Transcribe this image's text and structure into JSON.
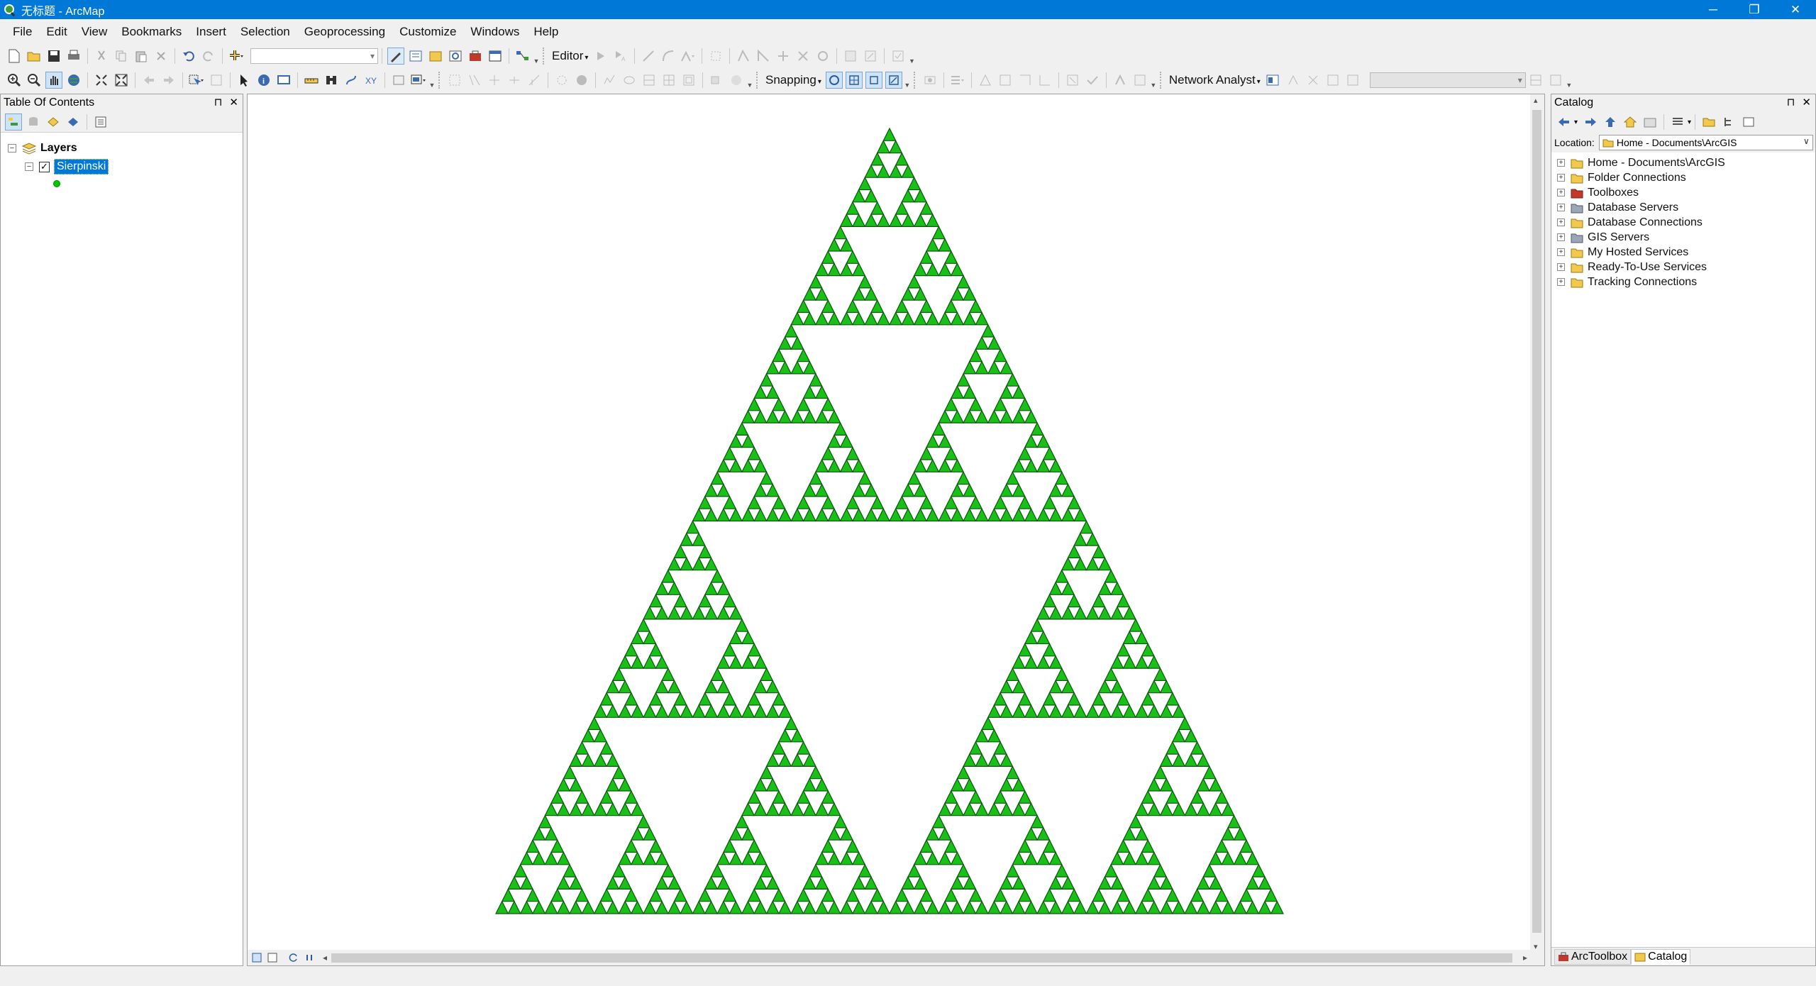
{
  "window": {
    "title": "无标题 - ArcMap",
    "minimize": "─",
    "restore": "❐",
    "close": "✕"
  },
  "menu": [
    "File",
    "Edit",
    "View",
    "Bookmarks",
    "Insert",
    "Selection",
    "Geoprocessing",
    "Customize",
    "Windows",
    "Help"
  ],
  "toolbar": {
    "editor_label": "Editor",
    "snapping_label": "Snapping",
    "network_analyst_label": "Network Analyst"
  },
  "toc": {
    "title": "Table Of Contents",
    "group_label": "Layers",
    "layer_label": "Sierpinski",
    "layer_checked": true,
    "symbol_color": "#00c800",
    "pin_glyph": "📌",
    "close_glyph": "✕"
  },
  "map": {
    "layer": "Sierpinski",
    "fill_color": "#18c018",
    "outline_color": "#0a5a0a",
    "recursion_depth": 6
  },
  "catalog": {
    "title": "Catalog",
    "location_label": "Location:",
    "location_value": "Home - Documents\\ArcGIS",
    "items": [
      {
        "label": "Home - Documents\\ArcGIS",
        "icon": "home-folder-icon"
      },
      {
        "label": "Folder Connections",
        "icon": "folder-connections-icon"
      },
      {
        "label": "Toolboxes",
        "icon": "toolbox-icon"
      },
      {
        "label": "Database Servers",
        "icon": "database-server-icon"
      },
      {
        "label": "Database Connections",
        "icon": "database-connections-icon"
      },
      {
        "label": "GIS Servers",
        "icon": "gis-servers-icon"
      },
      {
        "label": "My Hosted Services",
        "icon": "hosted-services-icon"
      },
      {
        "label": "Ready-To-Use Services",
        "icon": "ready-to-use-services-icon"
      },
      {
        "label": "Tracking Connections",
        "icon": "tracking-connections-icon"
      }
    ],
    "tabs": [
      {
        "label": "ArcToolbox",
        "active": false
      },
      {
        "label": "Catalog",
        "active": true
      }
    ]
  }
}
